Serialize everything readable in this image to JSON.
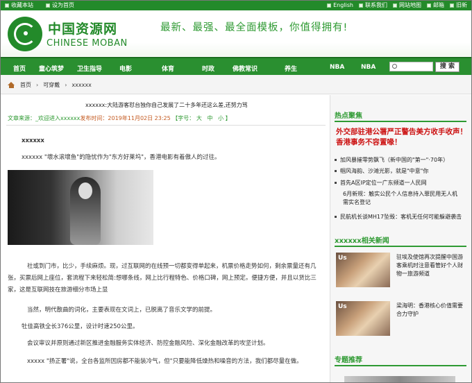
{
  "topbar": {
    "left": [
      "收藏本站",
      "设为首页"
    ],
    "right": [
      "English",
      "联系我们",
      "网站地图",
      "邮箱",
      "旧新"
    ]
  },
  "header": {
    "brand_cn": "中国资源网",
    "brand_en": "CHINESE MOBAN",
    "slogan": "最新、最强、最全面模板，你值得拥有!"
  },
  "nav": {
    "items": [
      "首页",
      "童心筑梦",
      "卫生指导",
      "电影",
      "体育",
      "时政",
      "佛教常识",
      "养生",
      "NBA",
      "NBA"
    ],
    "search_button": "搜 索"
  },
  "breadcrumb": [
    "首页",
    "可穿戴",
    "xxxxxx"
  ],
  "article": {
    "title": "xxxxxx:大陆游客怼台独你自己发展了二十多年还这么差,还努力骂",
    "meta": {
      "source_label": "文章来源：",
      "source": "_欢迎进入xxxxxx",
      "published": "发布时间：2019年11月02日 23:25",
      "font_label": "【字号：",
      "sizes": [
        "大",
        "中",
        "小"
      ],
      "font_close": "】"
    },
    "byline": "xxxxxx",
    "p1": "xxxxxx \"壞水滚壞鱼\"的隐忧作为\"东方好莱坞\"，香港电影有着傲人的过往。",
    "p2": "社或到门市，比少，手续麻烦。现，过互联网的在线预一切都变得单起来，机票价格走势如何，剩余票量还有几张，买票后网上座位，套流程下来轻松简:想哪条线，网上比行程特色、价格口碑，网上预定。便捷方便，并且以货比三家，这是互联网技在旅游细分市场上显",
    "p3": "当然，明代散曲的词化，主要表现在文词上，已脱离了音乐文学的前提。",
    "p4": "牡佳高铁全长376公里，设计时速250公里。",
    "p5": "会议审议并原则通过新区推进金融服务实体经济、防控金融风险、深化金融改革的攻坚计划。",
    "p6": "xxxxx \"扬正署\"说，全台各监所因房都不能装冷气，但\"只要能降低燥热和噪音的方法，我们都尽量在做。"
  },
  "sidebar": {
    "hot_title": "热点聚焦",
    "headline": "外交部驻港公署严正警告美方收手收声！香港事务不容置喙！",
    "items": [
      "加风暴摧零势飘飞（新中国的\"第一\"·70年）",
      "帼风海韵、沙滩光影，就是\"中意\"你",
      "首先A区IP定位一广东频道一人民网",
      "6月新规：触实公民个人信息持入罪民用无人机需实名登记",
      "民航机长谈MH17坠毁：客机无任何可能躲避袭击"
    ],
    "related_title": "xxxxxx相关新闻",
    "related": [
      {
        "img_text": "Us",
        "text": "驻埃及使馆再次提醒中国游客乘机时注意看管好个人财物一旅游频道"
      },
      {
        "img_text": "Us",
        "text": "梁海明：香港核心价值需要合力守护"
      }
    ],
    "special_title": "专题推荐"
  }
}
